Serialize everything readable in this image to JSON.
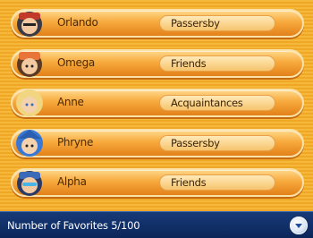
{
  "contacts": [
    {
      "name": "Orlando",
      "relation": "Passersby",
      "avatar_icon": "trainer-orlando-icon"
    },
    {
      "name": "Omega",
      "relation": "Friends",
      "avatar_icon": "trainer-omega-icon"
    },
    {
      "name": "Anne",
      "relation": "Acquaintances",
      "avatar_icon": "trainer-anne-icon"
    },
    {
      "name": "Phryne",
      "relation": "Passersby",
      "avatar_icon": "trainer-phryne-icon"
    },
    {
      "name": "Alpha",
      "relation": "Friends",
      "avatar_icon": "trainer-alpha-icon"
    }
  ],
  "footer": {
    "favorites_text": "Number of Favorites 5/100",
    "button_icon": "scroll-down-icon"
  },
  "colors": {
    "row_orange": "#f7a93c",
    "footer_blue": "#163a78"
  }
}
